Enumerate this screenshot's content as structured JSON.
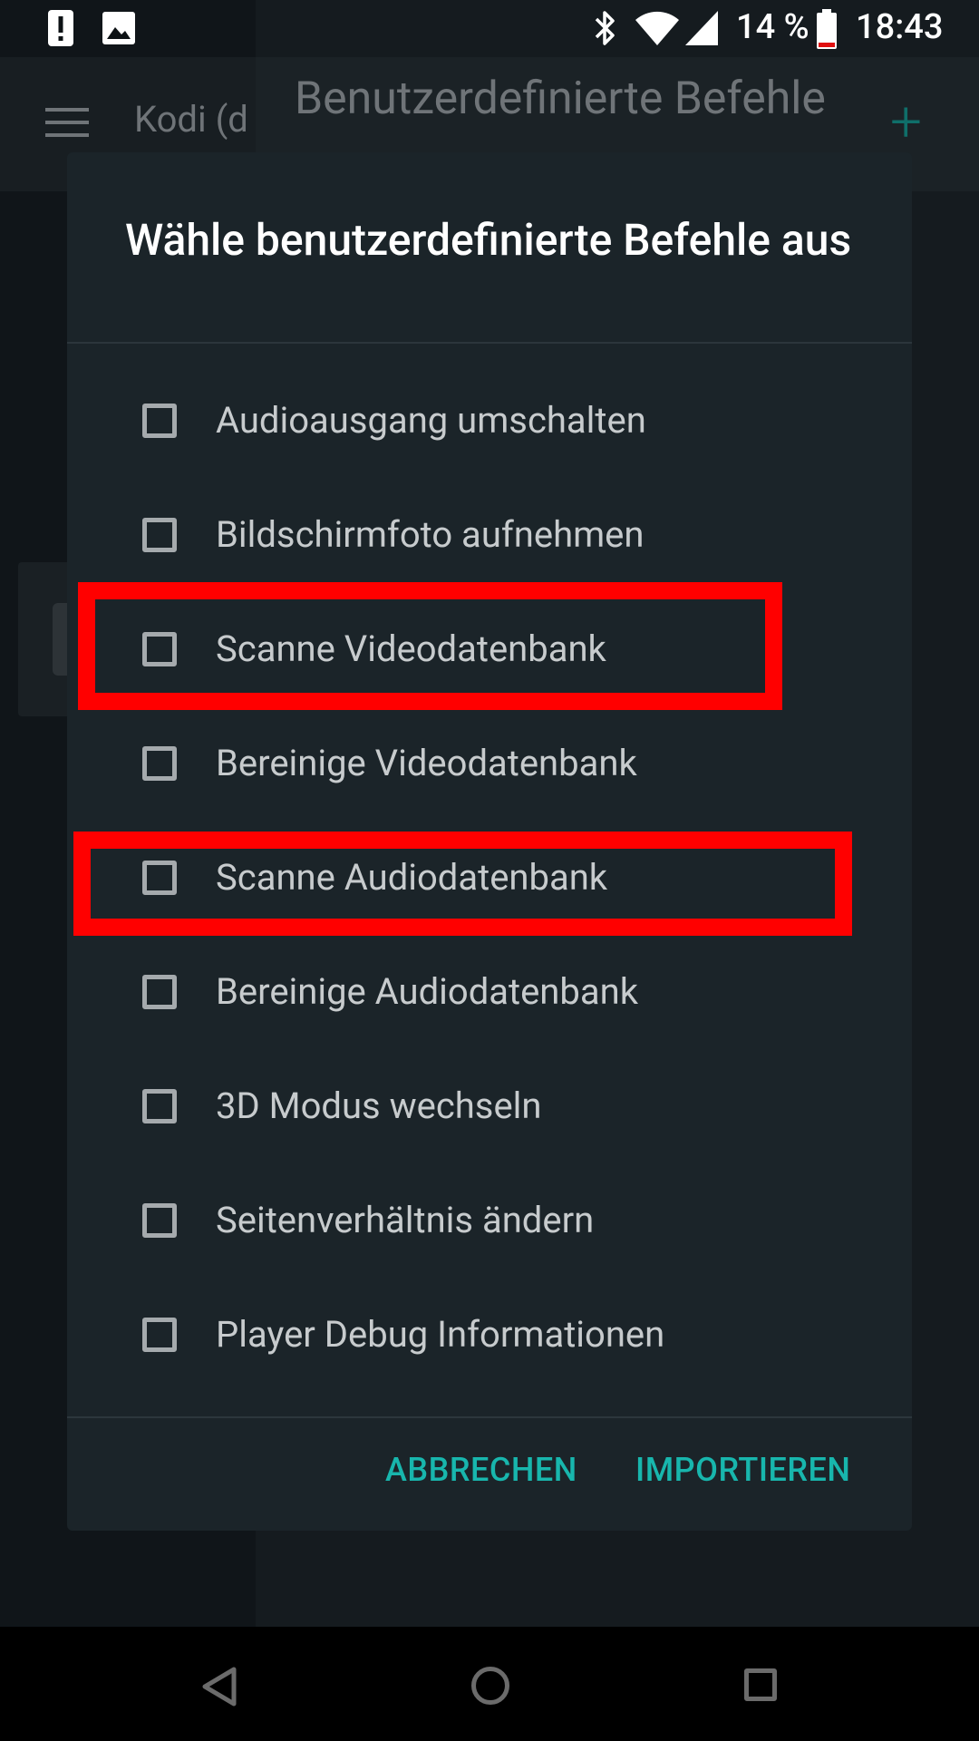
{
  "status_bar": {
    "icons": [
      "alert-icon",
      "image-icon",
      "bluetooth-icon",
      "wifi-icon",
      "signal-icon",
      "battery-icon"
    ],
    "battery": "14 %",
    "time": "18:43"
  },
  "background_app": {
    "host": "Kodi (d",
    "title": "Benutzerdefinierte Befehle",
    "accent_color": "#0f6f6a"
  },
  "dialog": {
    "title": "Wähle benutzerdefinierte Befehle aus",
    "options": [
      {
        "label": "Audioausgang umschalten",
        "checked": false
      },
      {
        "label": "Bildschirmfoto aufnehmen",
        "checked": false
      },
      {
        "label": "Scanne Videodatenbank",
        "checked": false,
        "highlighted": true
      },
      {
        "label": "Bereinige Videodatenbank",
        "checked": false
      },
      {
        "label": "Scanne Audiodatenbank",
        "checked": false,
        "highlighted": true
      },
      {
        "label": "Bereinige Audiodatenbank",
        "checked": false
      },
      {
        "label": "3D Modus wechseln",
        "checked": false
      },
      {
        "label": "Seitenverhältnis ändern",
        "checked": false
      },
      {
        "label": "Player Debug Informationen",
        "checked": false
      }
    ],
    "cancel_label": "ABBRECHEN",
    "import_label": "IMPORTIEREN",
    "button_color": "#18b6ad"
  },
  "annotation_color": "#ff0000"
}
